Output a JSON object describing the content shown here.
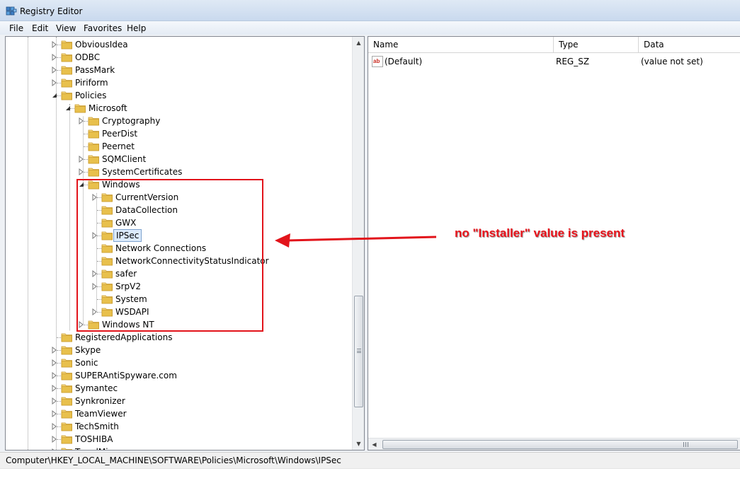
{
  "window": {
    "title": "Registry Editor"
  },
  "menu": {
    "items": [
      "File",
      "Edit",
      "View",
      "Favorites",
      "Help"
    ]
  },
  "tree": {
    "items": [
      {
        "label": "ObviousIdea",
        "expander": "collapsed"
      },
      {
        "label": "ODBC",
        "expander": "collapsed"
      },
      {
        "label": "PassMark",
        "expander": "collapsed"
      },
      {
        "label": "Piriform",
        "expander": "collapsed"
      },
      {
        "label": "Policies",
        "expander": "expanded"
      },
      {
        "label": "Microsoft",
        "expander": "expanded"
      },
      {
        "label": "Cryptography",
        "expander": "collapsed"
      },
      {
        "label": "PeerDist",
        "expander": "none"
      },
      {
        "label": "Peernet",
        "expander": "none"
      },
      {
        "label": "SQMClient",
        "expander": "collapsed"
      },
      {
        "label": "SystemCertificates",
        "expander": "collapsed"
      },
      {
        "label": "Windows",
        "expander": "expanded"
      },
      {
        "label": "CurrentVersion",
        "expander": "collapsed"
      },
      {
        "label": "DataCollection",
        "expander": "none"
      },
      {
        "label": "GWX",
        "expander": "none"
      },
      {
        "label": "IPSec",
        "expander": "collapsed",
        "selected": true
      },
      {
        "label": "Network Connections",
        "expander": "none"
      },
      {
        "label": "NetworkConnectivityStatusIndicator",
        "expander": "none"
      },
      {
        "label": "safer",
        "expander": "collapsed"
      },
      {
        "label": "SrpV2",
        "expander": "collapsed"
      },
      {
        "label": "System",
        "expander": "none"
      },
      {
        "label": "WSDAPI",
        "expander": "collapsed"
      },
      {
        "label": "Windows NT",
        "expander": "collapsed"
      },
      {
        "label": "RegisteredApplications",
        "expander": "none"
      },
      {
        "label": "Skype",
        "expander": "collapsed"
      },
      {
        "label": "Sonic",
        "expander": "collapsed"
      },
      {
        "label": "SUPERAntiSpyware.com",
        "expander": "collapsed"
      },
      {
        "label": "Symantec",
        "expander": "collapsed"
      },
      {
        "label": "Synkronizer",
        "expander": "collapsed"
      },
      {
        "label": "TeamViewer",
        "expander": "collapsed"
      },
      {
        "label": "TechSmith",
        "expander": "collapsed"
      },
      {
        "label": "TOSHIBA",
        "expander": "collapsed"
      },
      {
        "label": "TrendMicro",
        "expander": "collapsed"
      }
    ]
  },
  "list": {
    "columns": {
      "name": "Name",
      "type": "Type",
      "data": "Data"
    },
    "rows": [
      {
        "name": "(Default)",
        "type": "REG_SZ",
        "data": "(value not set)",
        "icon": "string-value-icon"
      }
    ]
  },
  "status": {
    "path": "Computer\\HKEY_LOCAL_MACHINE\\SOFTWARE\\Policies\\Microsoft\\Windows\\IPSec"
  },
  "annotation": {
    "text": "no \"Installer\" value is present",
    "color": "#e2141b"
  },
  "colors": {
    "folder": "#e8c04c",
    "selection": "#dcebfc",
    "annotation": "#e2141b"
  }
}
